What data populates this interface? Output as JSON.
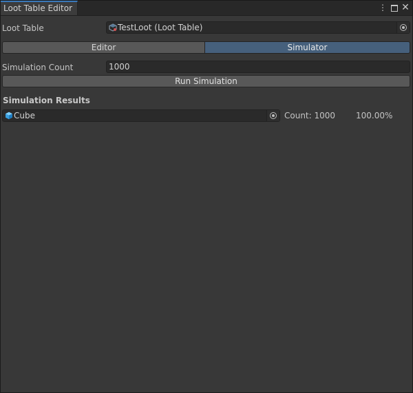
{
  "window": {
    "tab_title": "Loot Table Editor",
    "controls": {
      "menu": "⋮",
      "close": "✕"
    }
  },
  "loot_table": {
    "label": "Loot Table",
    "value": "TestLoot (Loot Table)"
  },
  "mode_toggle": {
    "options": [
      "Editor",
      "Simulator"
    ],
    "selected": "Simulator"
  },
  "simulation": {
    "count_label": "Simulation Count",
    "count_value": "1000",
    "run_button": "Run Simulation"
  },
  "results": {
    "heading": "Simulation Results",
    "rows": [
      {
        "item": "Cube",
        "count": "Count: 1000",
        "percent": "100.00%"
      }
    ]
  },
  "colors": {
    "accent_selected": "#46607c",
    "tab_accent": "#3a79bb",
    "background": "#383838"
  }
}
